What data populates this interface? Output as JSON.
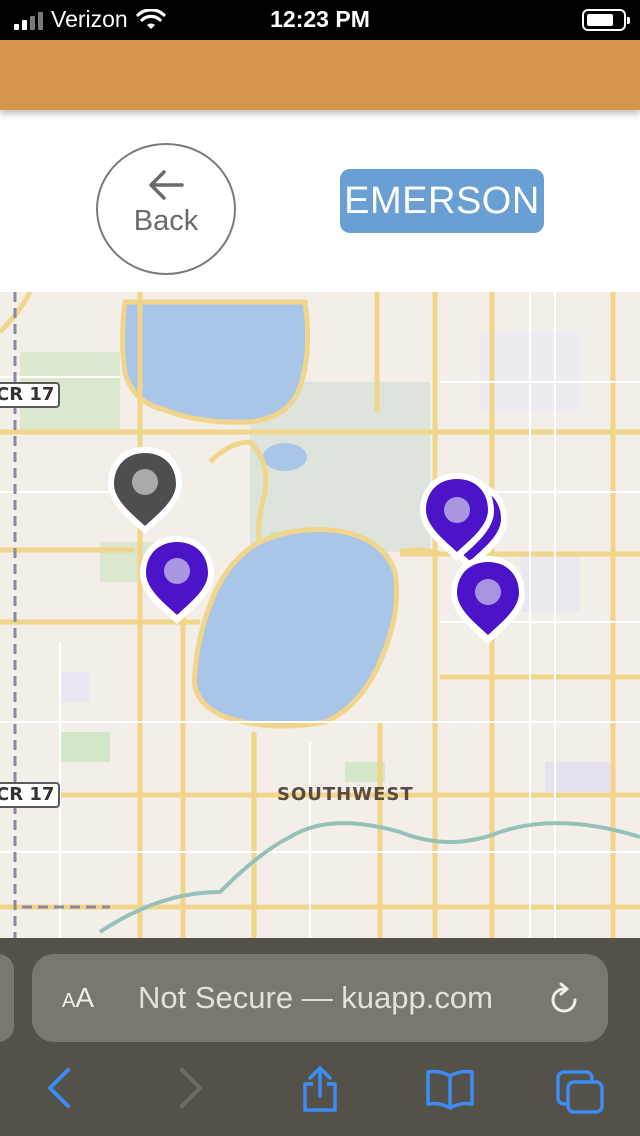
{
  "status_bar": {
    "carrier": "Verizon",
    "time": "12:23 PM"
  },
  "controls": {
    "back_label": "Back",
    "location_label": "EMERSON"
  },
  "map": {
    "neighborhood_label": "SOUTHWEST",
    "road_shields": [
      "CR 17",
      "CR 17"
    ],
    "markers": [
      {
        "name": "current-location",
        "color": "#4e4e50"
      },
      {
        "name": "location-1",
        "color": "#4b14c8"
      },
      {
        "name": "location-2",
        "color": "#4b14c8"
      },
      {
        "name": "location-3",
        "color": "#4b14c8"
      },
      {
        "name": "location-4",
        "color": "#4b14c8"
      }
    ]
  },
  "browser": {
    "text_size_label_small": "A",
    "text_size_label_large": "A",
    "url_text": "Not Secure — kuapp.com"
  },
  "colors": {
    "header": "#d4954a",
    "location_button": "#6a9fd3",
    "marker_active": "#4b14c8",
    "marker_current": "#4e4e50",
    "toolbar_icon": "#3d8cf5"
  }
}
